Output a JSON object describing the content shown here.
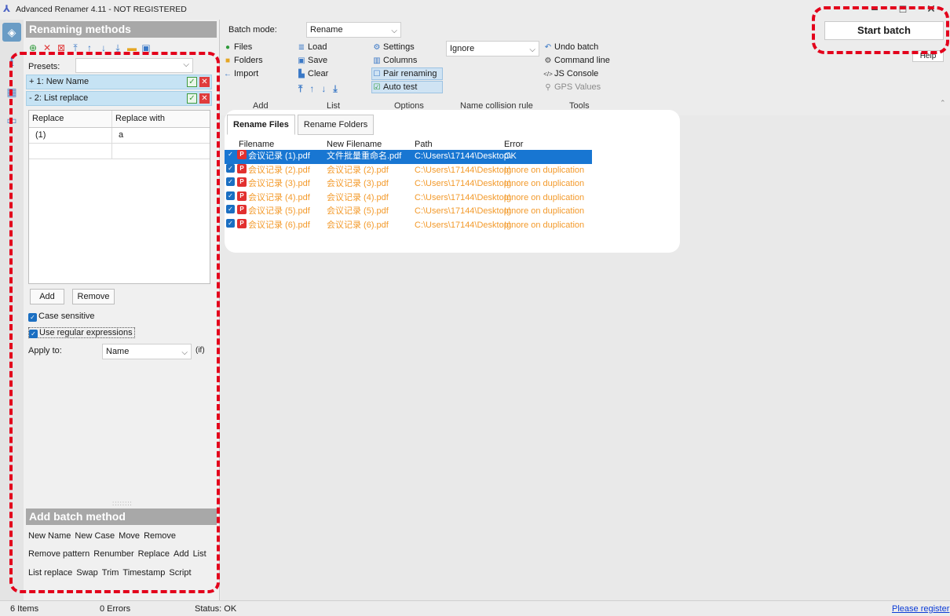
{
  "window": {
    "title": "Advanced Renamer 4.11 - NOT REGISTERED",
    "minimize": "–",
    "maximize": "□",
    "close": "✕"
  },
  "left_panel": {
    "heading": "Renaming methods",
    "presets_label": "Presets:",
    "presets_value": "",
    "methods": [
      {
        "label": "+ 1: New Name"
      },
      {
        "label": "- 2: List replace"
      }
    ],
    "table": {
      "headers": [
        "Replace",
        "Replace with"
      ],
      "rows": [
        [
          "(1)",
          "a"
        ],
        [
          "",
          ""
        ]
      ]
    },
    "add_button": "Add",
    "remove_button": "Remove",
    "case_sensitive": "Case sensitive",
    "use_regex": "Use regular expressions",
    "apply_to_label": "Apply to:",
    "apply_to_value": "Name",
    "if_label": "(if)",
    "add_batch_heading": "Add batch method",
    "batch_methods_row1": [
      "New Name",
      "New Case",
      "Move",
      "Remove"
    ],
    "batch_methods_row2": [
      "Remove pattern",
      "Renumber",
      "Replace",
      "Add",
      "List"
    ],
    "batch_methods_row3": [
      "List replace",
      "Swap",
      "Trim",
      "Timestamp",
      "Script"
    ]
  },
  "toolbar": {
    "batch_mode_label": "Batch mode:",
    "batch_mode_value": "Rename",
    "add": {
      "files": "Files",
      "folders": "Folders",
      "import": "Import",
      "label": "Add"
    },
    "list": {
      "load": "Load",
      "save": "Save",
      "clear": "Clear",
      "label": "List"
    },
    "options": {
      "settings": "Settings",
      "columns": "Columns",
      "pair_renaming": "Pair renaming",
      "auto_test": "Auto test",
      "label": "Options"
    },
    "collision": {
      "value": "Ignore",
      "label": "Name collision rule"
    },
    "tools": {
      "undo_batch": "Undo batch",
      "command_line": "Command line",
      "js_console": "JS Console",
      "gps_values": "GPS Values",
      "label": "Tools"
    },
    "start_batch": "Start batch",
    "help": "Help"
  },
  "tabs": [
    {
      "label": "Rename Files"
    },
    {
      "label": "Rename Folders"
    }
  ],
  "file_list": {
    "headers": [
      "Filename",
      "New Filename",
      "Path",
      "Error"
    ],
    "rows": [
      {
        "filename": "会议记录 (1).pdf",
        "new_filename": "文件批量重命名.pdf",
        "path": "C:\\Users\\17144\\Desktop\\",
        "error": "OK"
      },
      {
        "filename": "会议记录 (2).pdf",
        "new_filename": "会议记录 (2).pdf",
        "path": "C:\\Users\\17144\\Desktop\\",
        "error": "Ignore on duplication"
      },
      {
        "filename": "会议记录 (3).pdf",
        "new_filename": "会议记录 (3).pdf",
        "path": "C:\\Users\\17144\\Desktop\\",
        "error": "Ignore on duplication"
      },
      {
        "filename": "会议记录 (4).pdf",
        "new_filename": "会议记录 (4).pdf",
        "path": "C:\\Users\\17144\\Desktop\\",
        "error": "Ignore on duplication"
      },
      {
        "filename": "会议记录 (5).pdf",
        "new_filename": "会议记录 (5).pdf",
        "path": "C:\\Users\\17144\\Desktop\\",
        "error": "Ignore on duplication"
      },
      {
        "filename": "会议记录 (6).pdf",
        "new_filename": "会议记录 (6).pdf",
        "path": "C:\\Users\\17144\\Desktop\\",
        "error": "Ignore on duplication"
      }
    ]
  },
  "statusbar": {
    "items": "6 Items",
    "errors": "0 Errors",
    "status": "Status: OK",
    "register": "Please register"
  },
  "colors": {
    "selection": "#1876d2",
    "warning_text": "#f39a2b",
    "highlight_dash": "#e3001b",
    "method_row": "#c6e3f4"
  }
}
